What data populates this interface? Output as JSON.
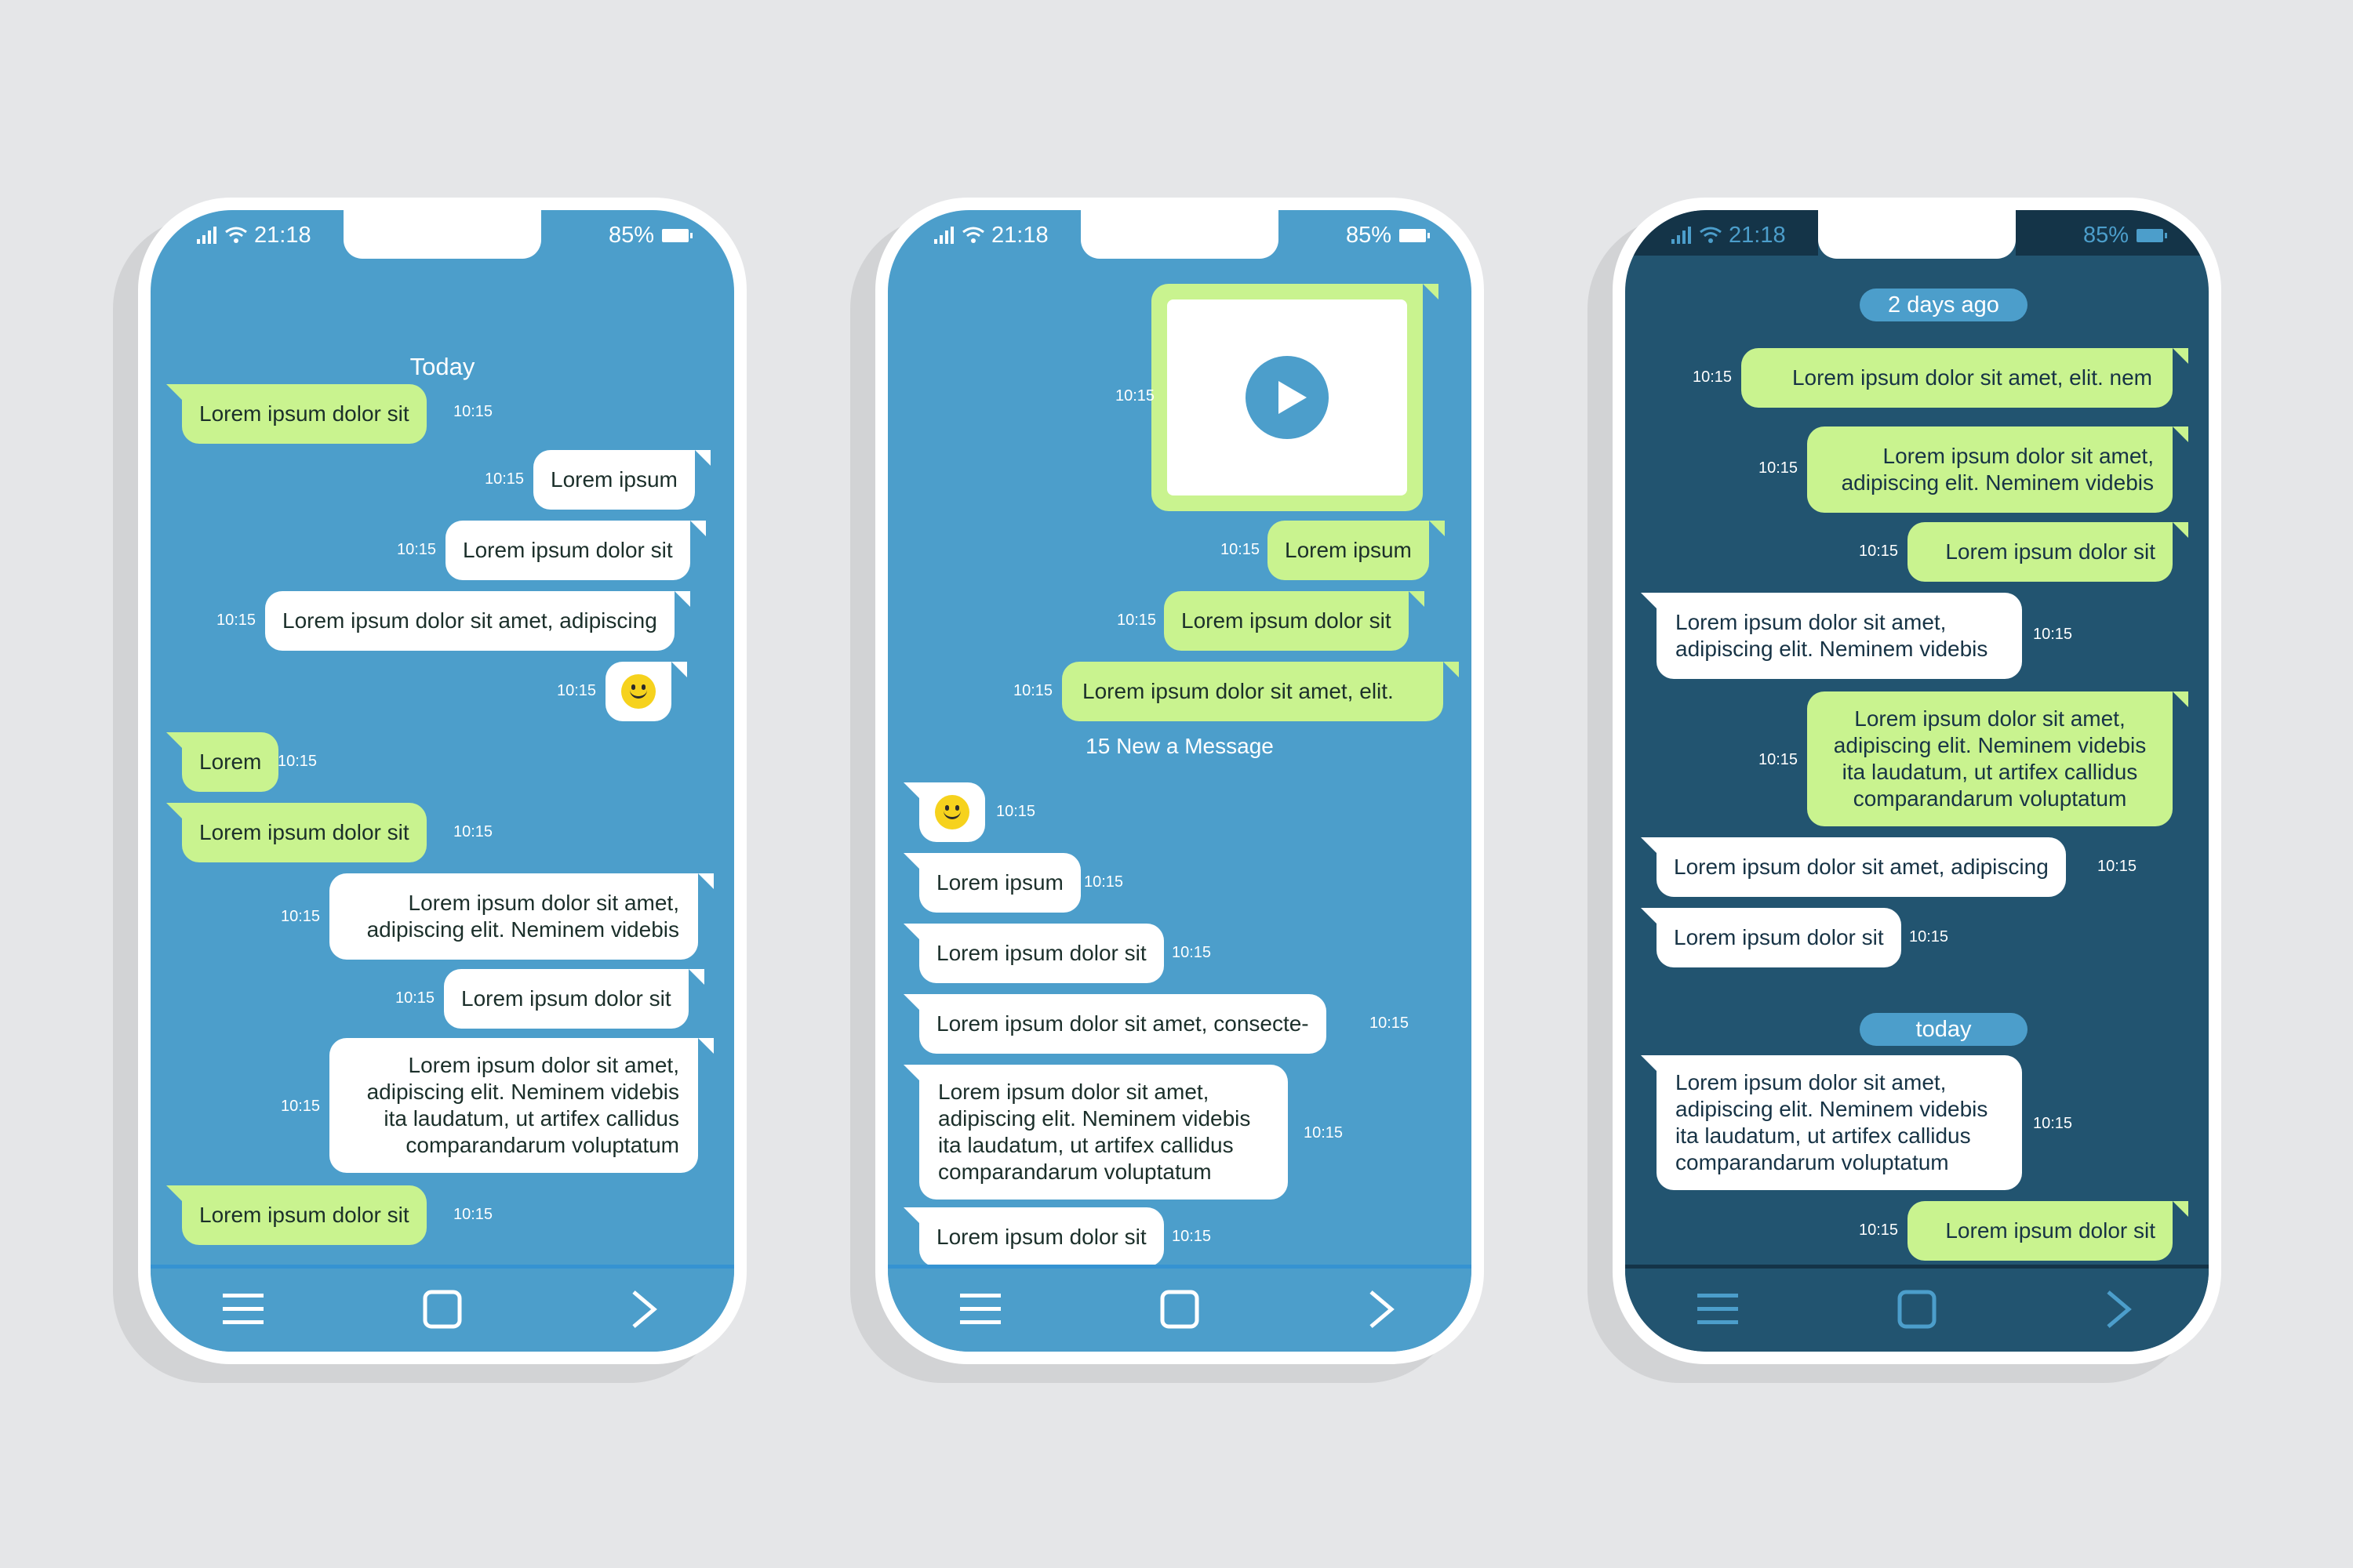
{
  "status": {
    "time": "21:18",
    "battery": "85%"
  },
  "phones": {
    "left": {
      "date_label": "Today",
      "messages": [
        {
          "text": "Lorem ipsum dolor sit",
          "time": "10:15"
        },
        {
          "text": "Lorem ipsum",
          "time": "10:15"
        },
        {
          "text": "Lorem ipsum dolor sit",
          "time": "10:15"
        },
        {
          "text": "Lorem ipsum dolor sit amet, adipiscing",
          "time": "10:15"
        },
        {
          "text": "",
          "time": "10:15"
        },
        {
          "text": "Lorem",
          "time": "10:15"
        },
        {
          "text": "Lorem ipsum dolor sit",
          "time": "10:15"
        },
        {
          "text": "Lorem ipsum dolor sit amet, adipiscing elit. Neminem videbis",
          "time": "10:15"
        },
        {
          "text": "Lorem ipsum dolor sit",
          "time": "10:15"
        },
        {
          "text": "Lorem ipsum dolor sit amet, adipiscing elit. Neminem videbis ita laudatum, ut artifex callidus comparandarum voluptatum",
          "time": "10:15"
        },
        {
          "text": "Lorem ipsum dolor sit",
          "time": "10:15"
        }
      ]
    },
    "middle": {
      "new_message_label": "15 New a Message",
      "messages": [
        {
          "text": "",
          "time": "10:15"
        },
        {
          "text": "Lorem ipsum",
          "time": "10:15"
        },
        {
          "text": "Lorem ipsum dolor sit",
          "time": "10:15"
        },
        {
          "text": "Lorem ipsum dolor sit amet, elit.",
          "time": "10:15"
        },
        {
          "text": "",
          "time": "10:15"
        },
        {
          "text": "Lorem ipsum",
          "time": "10:15"
        },
        {
          "text": "Lorem ipsum dolor sit",
          "time": "10:15"
        },
        {
          "text": "Lorem ipsum dolor sit amet, consecte-",
          "time": "10:15"
        },
        {
          "text": "Lorem ipsum dolor sit amet, adipiscing elit. Neminem videbis ita laudatum, ut artifex callidus comparandarum voluptatum",
          "time": "10:15"
        },
        {
          "text": "Lorem ipsum dolor sit",
          "time": "10:15"
        }
      ]
    },
    "right": {
      "date_pill_1": "2 days ago",
      "date_pill_2": "today",
      "messages": [
        {
          "text": "Lorem ipsum dolor sit amet, elit. nem",
          "time": "10:15"
        },
        {
          "text": "Lorem ipsum dolor sit amet, adipiscing elit. Neminem videbis",
          "time": "10:15"
        },
        {
          "text": "Lorem ipsum dolor sit",
          "time": "10:15"
        },
        {
          "text": "Lorem ipsum dolor sit amet, adipiscing elit. Neminem videbis",
          "time": "10:15"
        },
        {
          "text": "Lorem ipsum dolor sit amet, adipiscing elit. Neminem videbis ita laudatum, ut artifex callidus comparandarum voluptatum",
          "time": "10:15"
        },
        {
          "text": "Lorem ipsum dolor sit amet, adipiscing",
          "time": "10:15"
        },
        {
          "text": "Lorem ipsum dolor sit",
          "time": "10:15"
        },
        {
          "text": "Lorem ipsum dolor sit amet, adipiscing elit. Neminem videbis ita laudatum, ut artifex callidus comparandarum voluptatum",
          "time": "10:15"
        },
        {
          "text": "Lorem ipsum dolor sit",
          "time": "10:15"
        }
      ]
    }
  },
  "icons": {
    "signal": "signal-icon",
    "wifi": "wifi-icon",
    "battery": "battery-icon",
    "menu": "menu-icon",
    "home": "home-square-icon",
    "forward": "chevron-right-icon",
    "emoji": "smiley-icon",
    "play": "play-icon"
  },
  "colors": {
    "background": "#e5e6e8",
    "screen_light": "#4c9ecb",
    "screen_dark": "#225470",
    "bubble_green": "#c9f38f",
    "bubble_white": "#ffffff",
    "emoji_yellow": "#f6d21d"
  }
}
